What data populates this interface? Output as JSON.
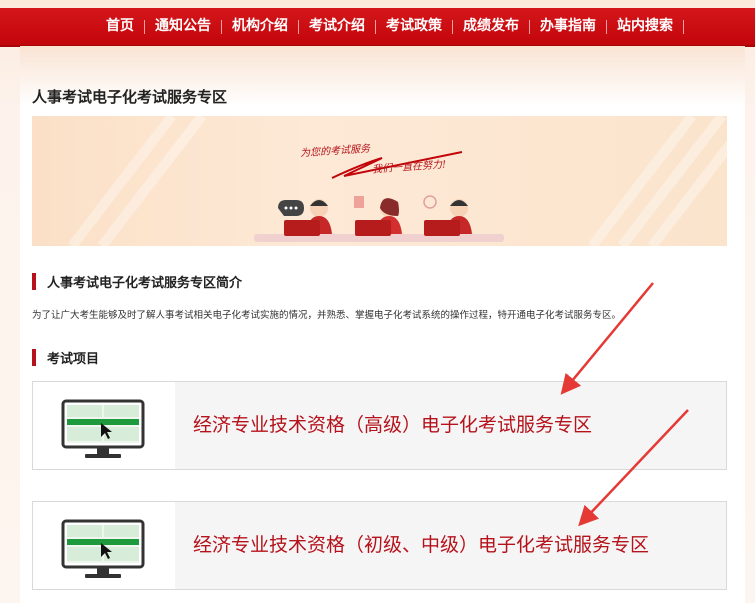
{
  "nav": {
    "items": [
      "首页",
      "通知公告",
      "机构介绍",
      "考试介绍",
      "考试政策",
      "成绩发布",
      "办事指南",
      "站内搜索"
    ]
  },
  "page": {
    "title": "人事考试电子化考试服务专区"
  },
  "banner": {
    "slogan_line1": "为您的考试服务",
    "slogan_line2": "我们一直在努力!"
  },
  "intro_section": {
    "heading": "人事考试电子化考试服务专区简介",
    "text": "为了让广大考生能够及时了解人事考试相关电子化考试实施的情况，并熟悉、掌握电子化考试系统的操作过程，特开通电子化考试服务专区。"
  },
  "projects_section": {
    "heading": "考试项目",
    "cards": [
      {
        "title": "经济专业技术资格（高级）电子化考试服务专区"
      },
      {
        "title": "经济专业技术资格（初级、中级）电子化考试服务专区"
      }
    ]
  },
  "colors": {
    "brand_red": "#c2050a",
    "title_red": "#b5121b",
    "accent_green": "#1e9a3c"
  }
}
